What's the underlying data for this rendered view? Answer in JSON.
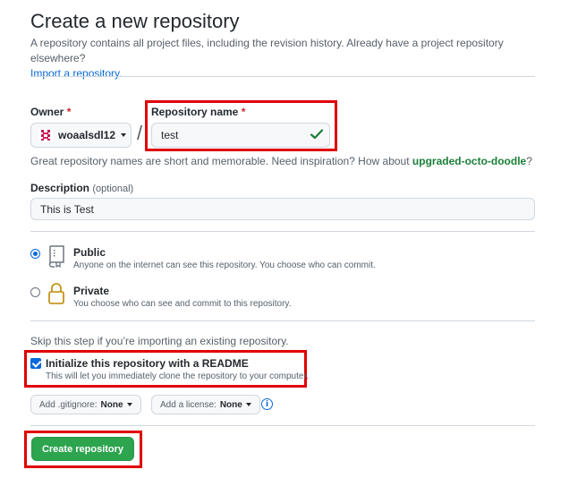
{
  "header": {
    "title": "Create a new repository",
    "subtitle": "A repository contains all project files, including the revision history. Already have a project repository elsewhere?",
    "import_link": "Import a repository."
  },
  "owner": {
    "label": "Owner",
    "required_mark": "*",
    "value": "woaalsdl12"
  },
  "repo_name": {
    "label": "Repository name",
    "required_mark": "*",
    "value": "test",
    "slash": "/"
  },
  "name_hint": {
    "text": "Great repository names are short and memorable. Need inspiration? How about",
    "suggestion": "upgraded-octo-doodle",
    "suffix": "?"
  },
  "description": {
    "label": "Description",
    "optional": "(optional)",
    "value": "This is Test"
  },
  "visibility": {
    "public": {
      "title": "Public",
      "desc": "Anyone on the internet can see this repository. You choose who can commit.",
      "selected": true
    },
    "private": {
      "title": "Private",
      "desc": "You choose who can see and commit to this repository.",
      "selected": false
    }
  },
  "init": {
    "skip_text": "Skip this step if you’re importing an existing repository.",
    "readme_title": "Initialize this repository with a README",
    "readme_desc": "This will let you immediately clone the repository to your computer.",
    "readme_checked": true
  },
  "gitignore": {
    "label": "Add .gitignore:",
    "value": "None"
  },
  "license": {
    "label": "Add a license:",
    "value": "None"
  },
  "info_glyph": "i",
  "create_button": "Create repository",
  "colors": {
    "accent": "#0969da",
    "success": "#2da44e",
    "highlight": "#e00000"
  }
}
